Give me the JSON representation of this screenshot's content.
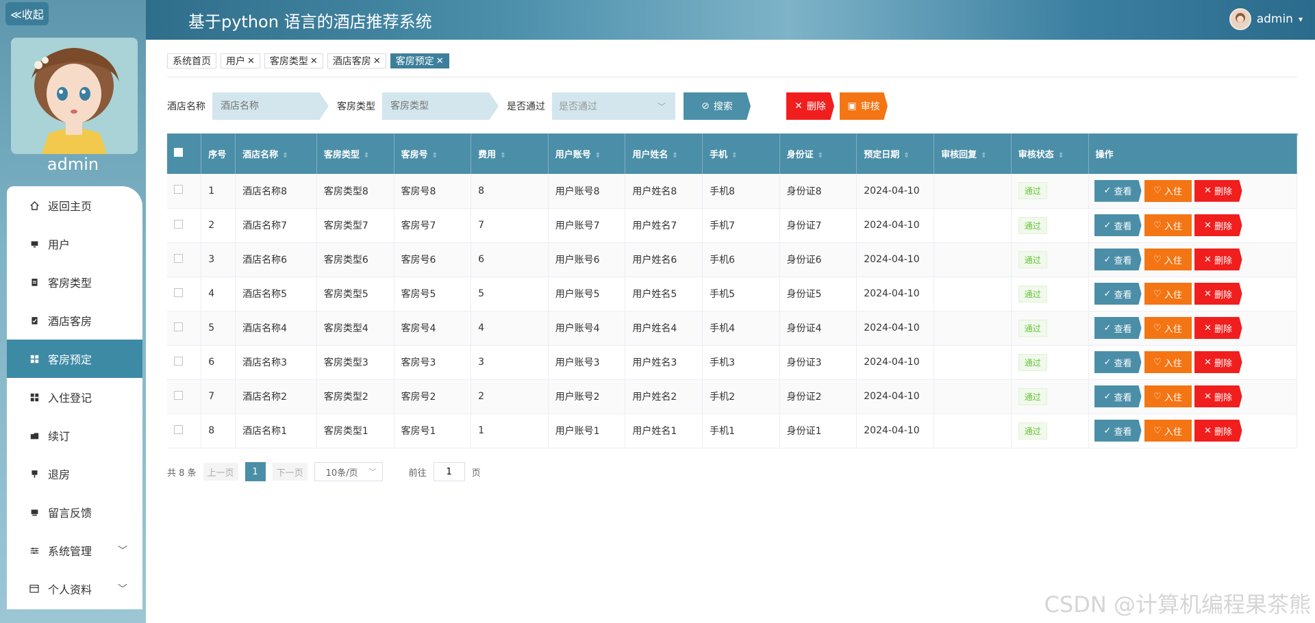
{
  "sidebar": {
    "collapse_label": "≪收起",
    "username": "admin",
    "items": [
      {
        "label": "返回主页",
        "icon": "home-icon"
      },
      {
        "label": "用户",
        "icon": "monitor-icon"
      },
      {
        "label": "客房类型",
        "icon": "clipboard-icon"
      },
      {
        "label": "酒店客房",
        "icon": "clipboard-check-icon"
      },
      {
        "label": "客房预定",
        "icon": "grid-icon"
      },
      {
        "label": "入住登记",
        "icon": "grid-icon"
      },
      {
        "label": "续订",
        "icon": "folder-icon"
      },
      {
        "label": "退房",
        "icon": "phone-icon"
      },
      {
        "label": "留言反馈",
        "icon": "monitor-icon"
      },
      {
        "label": "系统管理",
        "icon": "sliders-icon"
      },
      {
        "label": "个人资料",
        "icon": "card-icon"
      }
    ]
  },
  "header": {
    "title": "基于python 语言的酒店推荐系统",
    "user": "admin"
  },
  "tabs": [
    {
      "label": "系统首页"
    },
    {
      "label": "用户"
    },
    {
      "label": "客房类型"
    },
    {
      "label": "酒店客房"
    },
    {
      "label": "客房预定"
    }
  ],
  "search": {
    "hotel_label": "酒店名称",
    "hotel_placeholder": "酒店名称",
    "type_label": "客房类型",
    "type_placeholder": "客房类型",
    "pass_label": "是否通过",
    "pass_placeholder": "是否通过",
    "search_btn": "搜索",
    "delete_btn": "删除",
    "audit_btn": "审核"
  },
  "table": {
    "columns": [
      "序号",
      "酒店名称",
      "客房类型",
      "客房号",
      "费用",
      "用户账号",
      "用户姓名",
      "手机",
      "身份证",
      "预定日期",
      "审核回复",
      "审核状态",
      "操作"
    ],
    "rows": [
      [
        "1",
        "酒店名称8",
        "客房类型8",
        "客房号8",
        "8",
        "用户账号8",
        "用户姓名8",
        "手机8",
        "身份证8",
        "2024-04-10",
        "",
        "通过"
      ],
      [
        "2",
        "酒店名称7",
        "客房类型7",
        "客房号7",
        "7",
        "用户账号7",
        "用户姓名7",
        "手机7",
        "身份证7",
        "2024-04-10",
        "",
        "通过"
      ],
      [
        "3",
        "酒店名称6",
        "客房类型6",
        "客房号6",
        "6",
        "用户账号6",
        "用户姓名6",
        "手机6",
        "身份证6",
        "2024-04-10",
        "",
        "通过"
      ],
      [
        "4",
        "酒店名称5",
        "客房类型5",
        "客房号5",
        "5",
        "用户账号5",
        "用户姓名5",
        "手机5",
        "身份证5",
        "2024-04-10",
        "",
        "通过"
      ],
      [
        "5",
        "酒店名称4",
        "客房类型4",
        "客房号4",
        "4",
        "用户账号4",
        "用户姓名4",
        "手机4",
        "身份证4",
        "2024-04-10",
        "",
        "通过"
      ],
      [
        "6",
        "酒店名称3",
        "客房类型3",
        "客房号3",
        "3",
        "用户账号3",
        "用户姓名3",
        "手机3",
        "身份证3",
        "2024-04-10",
        "",
        "通过"
      ],
      [
        "7",
        "酒店名称2",
        "客房类型2",
        "客房号2",
        "2",
        "用户账号2",
        "用户姓名2",
        "手机2",
        "身份证2",
        "2024-04-10",
        "",
        "通过"
      ],
      [
        "8",
        "酒店名称1",
        "客房类型1",
        "客房号1",
        "1",
        "用户账号1",
        "用户姓名1",
        "手机1",
        "身份证1",
        "2024-04-10",
        "",
        "通过"
      ]
    ],
    "actions": {
      "view": "查看",
      "checkin": "入住",
      "delete": "删除"
    }
  },
  "pagination": {
    "total": "共 8 条",
    "prev": "上一页",
    "page": "1",
    "next": "下一页",
    "size": "10条/页",
    "goto": "前往",
    "goto_value": "1",
    "page_unit": "页"
  },
  "watermark": "CSDN @计算机编程果茶熊"
}
